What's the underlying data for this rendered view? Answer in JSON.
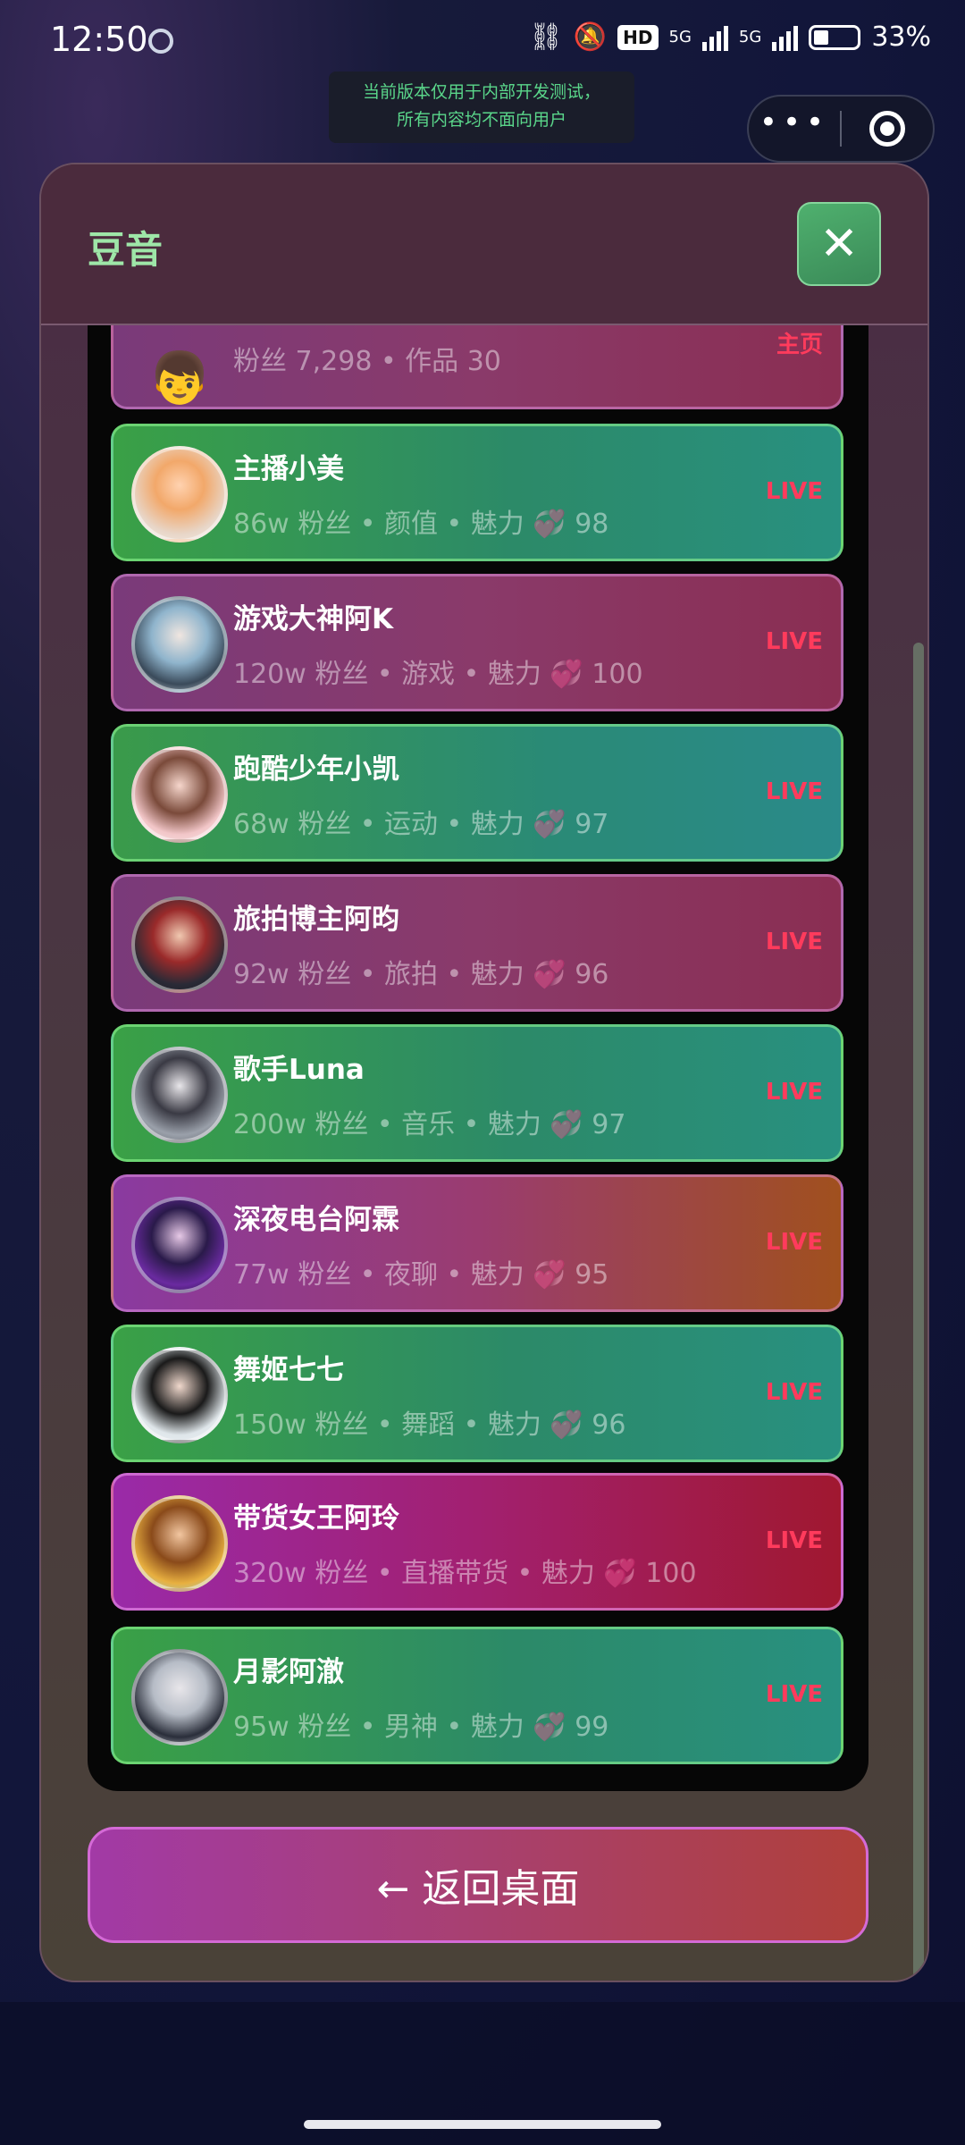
{
  "status_bar": {
    "time": "12:50",
    "network_left": "5G",
    "network_right": "5G",
    "hd_label": "HD",
    "battery": "33%"
  },
  "dev_tip": {
    "line1": "当前版本仅用于内部开发测试，",
    "line2": "所有内容均不面向用户"
  },
  "capsule": {
    "more": "•••"
  },
  "modal": {
    "title": "豆音",
    "close": "✕"
  },
  "top_partial": {
    "avatar": "👦",
    "meta": "粉丝 7,298 • 作品 30",
    "tag": "主页"
  },
  "streamers": [
    {
      "name": "主播小美",
      "meta": "86w 粉丝  •  颜值  •  魅力 💞 98",
      "live": "LIVE"
    },
    {
      "name": "游戏大神阿K",
      "meta": "120w 粉丝  •  游戏  •  魅力 💞 100",
      "live": "LIVE"
    },
    {
      "name": "跑酷少年小凯",
      "meta": "68w 粉丝  •  运动  •  魅力 💞 97",
      "live": "LIVE"
    },
    {
      "name": "旅拍博主阿昀",
      "meta": "92w 粉丝  •  旅拍  •  魅力 💞 96",
      "live": "LIVE"
    },
    {
      "name": "歌手Luna",
      "meta": "200w 粉丝  •  音乐  •  魅力 💞 97",
      "live": "LIVE"
    },
    {
      "name": "深夜电台阿霖",
      "meta": "77w 粉丝  •  夜聊  •  魅力 💞 95",
      "live": "LIVE"
    },
    {
      "name": "舞姬七七",
      "meta": "150w 粉丝  •  舞蹈  •  魅力 💞 96",
      "live": "LIVE"
    },
    {
      "name": "带货女王阿玲",
      "meta": "320w 粉丝  •  直播带货  •  魅力 💞 100",
      "live": "LIVE"
    },
    {
      "name": "月影阿澈",
      "meta": "95w 粉丝  •  男神  •  魅力 💞 99",
      "live": "LIVE"
    }
  ],
  "back_button": "← 返回桌面",
  "colors": {
    "accent_green": "#9ee6a8",
    "live_red": "#ff3b5c"
  }
}
